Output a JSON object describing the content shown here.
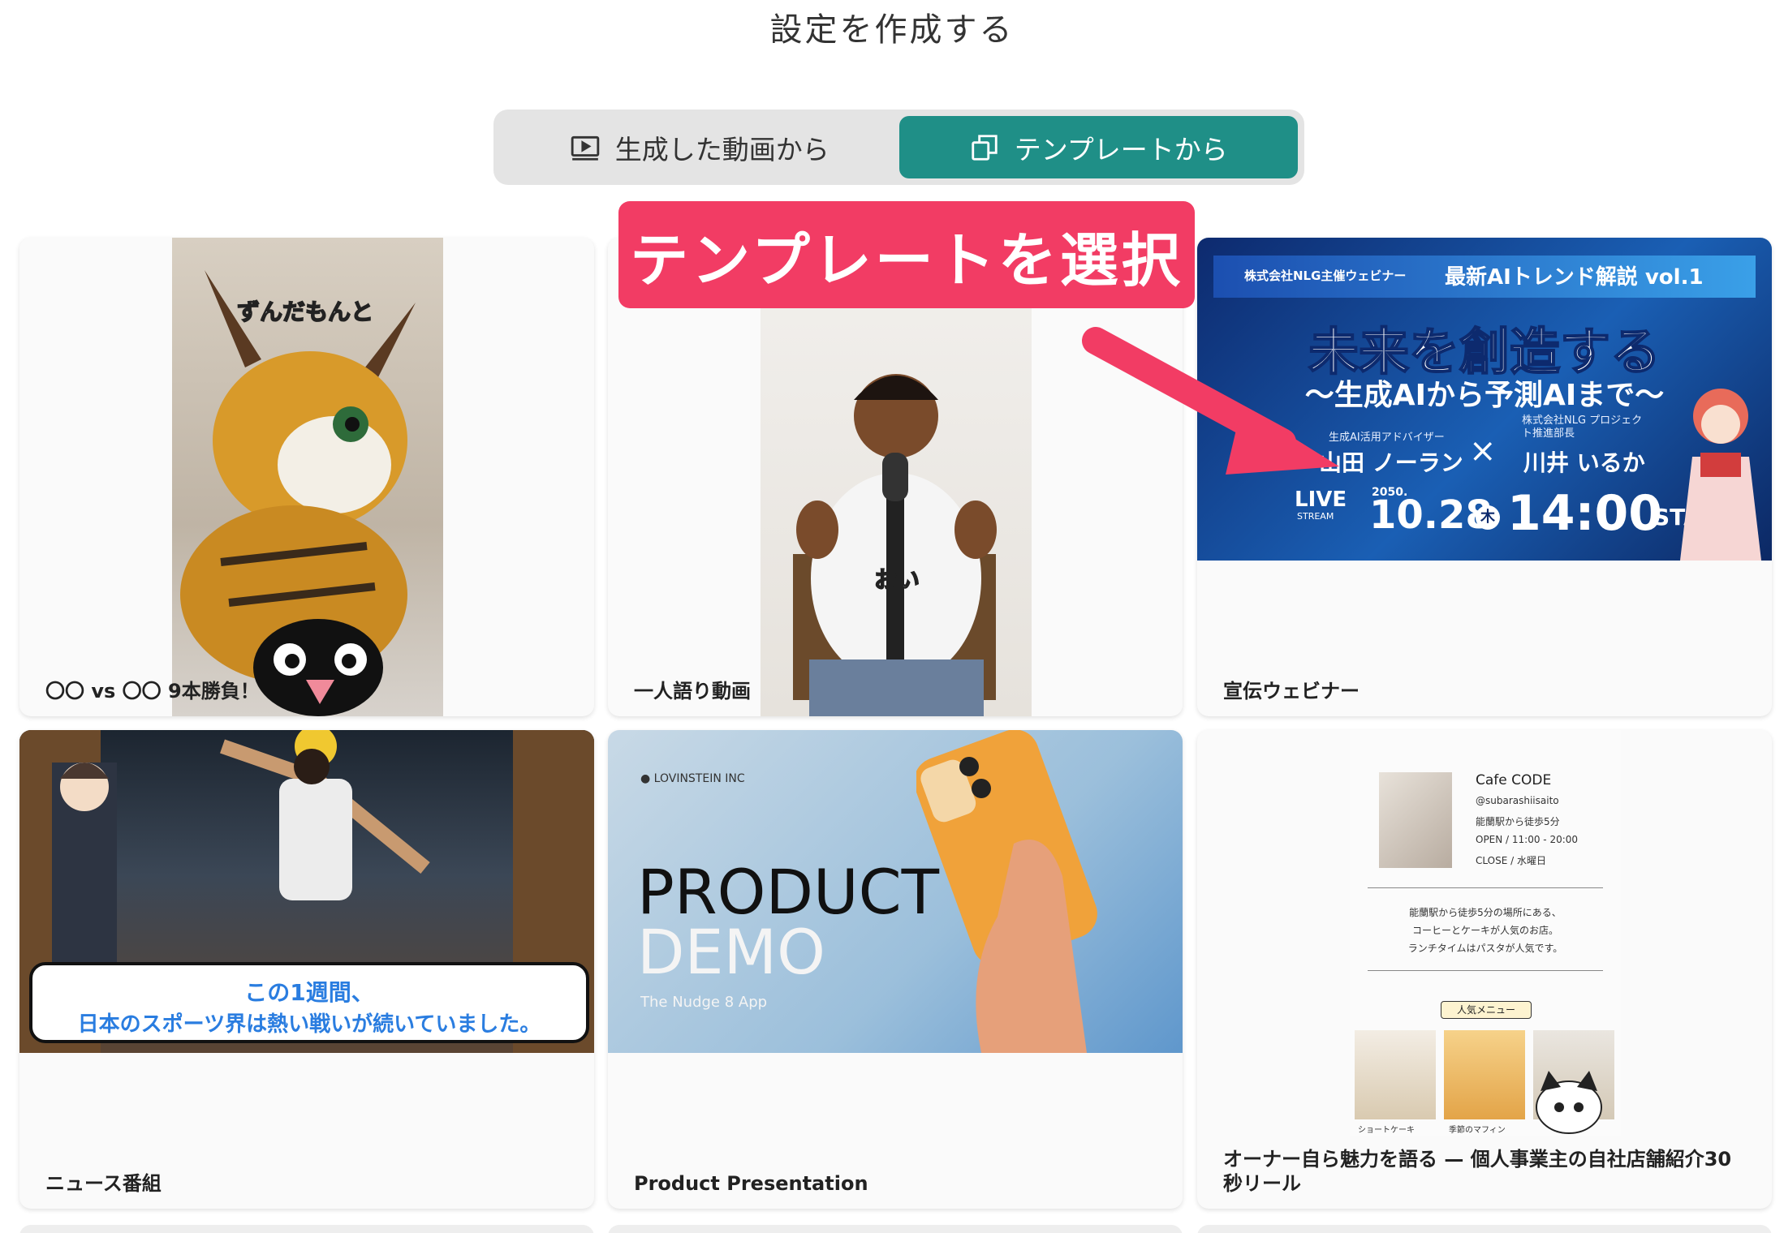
{
  "page": {
    "title": "設定を作成する"
  },
  "segmented": {
    "from_video": "生成した動画から",
    "from_template": "テンプレートから"
  },
  "callout": {
    "text": "テンプレートを選択"
  },
  "cards": [
    {
      "label": "〇〇 vs 〇〇 9本勝負！",
      "caption": "ずんだもんと"
    },
    {
      "label": "一人語り動画",
      "caption": "おい"
    },
    {
      "label": "宣伝ウェビナー",
      "webinar": {
        "host": "株式会社NLG主催ウェビナー",
        "series": "最新AIトレンド解説 vol.1",
        "headline": "未来を創造する",
        "subhead": "〜生成AIから予測AIまで〜",
        "speaker1_role": "生成AI活用アドバイザー",
        "speaker1_name": "山田 ノーラン",
        "speaker2_role": "株式会社NLG プロジェクト推進部長",
        "speaker2_name": "川井 いるか",
        "live": "LIVE",
        "stream": "STREAM",
        "year": "2050.",
        "date": "10.28",
        "dow": "木",
        "time": "14:00",
        "start": "STA"
      }
    },
    {
      "label": "ニュース番組",
      "caption_line1": "この1週間、",
      "caption_line2": "日本のスポーツ界は熱い戦いが続いていました。"
    },
    {
      "label": "Product Presentation",
      "brand": "LOVINSTEIN INC",
      "title1": "PRODUCT",
      "title2": "DEMO",
      "sub": "The Nudge 8 App"
    },
    {
      "label": "オーナー自ら魅力を語る — 個人事業主の自社店舗紹介30秒リール",
      "cafe": {
        "name": "Cafe CODE",
        "handle": "@subarashiisaito",
        "access": "能蘭駅から徒歩5分",
        "open": "OPEN / 11:00 - 20:00",
        "close": "CLOSE / 水曜日",
        "desc1": "能蘭駅から徒歩5分の場所にある、",
        "desc2": "コーヒーとケーキが人気のお店。",
        "desc3": "ランチタイムはパスタが人気です。",
        "menu_title": "人気メニュー",
        "item1": "ショートケーキ",
        "item2": "季節のマフィン"
      }
    }
  ],
  "colors": {
    "accent": "#1f8f87",
    "callout": "#f23c64"
  }
}
